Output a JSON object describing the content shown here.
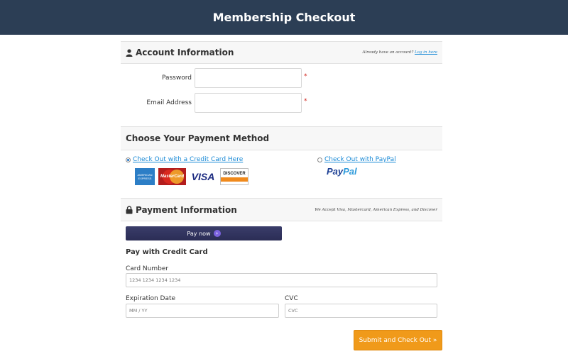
{
  "header": {
    "title": "Membership Checkout"
  },
  "account": {
    "title": "Account Information",
    "aside_prefix": "Already have an account?",
    "aside_link": "Log in here",
    "password_label": "Password",
    "email_label": "Email Address",
    "required_mark": "*"
  },
  "payment_method": {
    "title": "Choose Your Payment Method",
    "credit_card_option": "Check Out with a Credit Card Here",
    "paypal_option": "Check Out with PayPal",
    "selected": "credit_card",
    "cards": {
      "amex_line1": "AMERICAN",
      "amex_line2": "EXPRESS",
      "mastercard": "MasterCard",
      "visa": "VISA",
      "discover": "DISCOVER"
    },
    "paypal_logo_pay": "Pay",
    "paypal_logo_pal": "Pal"
  },
  "payment_info": {
    "title": "Payment Information",
    "aside": "We Accept Visa, Mastercard, American Express, and Discover",
    "pay_now_label": "Pay now",
    "pay_now_arrow": "›",
    "subtitle": "Pay with Credit Card",
    "card_number_label": "Card Number",
    "card_number_placeholder": "1234 1234 1234 1234",
    "expiration_label": "Expiration Date",
    "expiration_placeholder": "MM / YY",
    "cvc_label": "CVC",
    "cvc_placeholder": "CVC"
  },
  "submit": {
    "label": "Submit and Check Out »"
  },
  "colors": {
    "header_bg": "#2c3e55",
    "accent_orange": "#f09a1a",
    "link_blue": "#1a8ad6",
    "required_red": "#d0241d",
    "paynow_bg": "#2b2d55"
  },
  "icons": {
    "account": "user-icon",
    "payment_info": "lock-icon"
  }
}
